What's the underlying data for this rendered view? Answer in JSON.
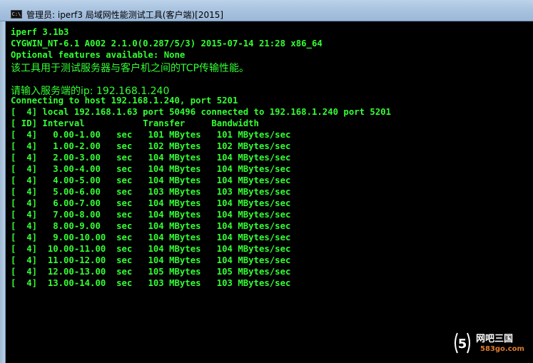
{
  "window": {
    "title": "管理员: iperf3 局域网性能测试工具(客户端)[2015]",
    "icon_label": "C:\\",
    "icon": "console-window-icon"
  },
  "console": {
    "lines": [
      "iperf 3.1b3",
      "CYGWIN_NT-6.1 A002 2.1.0(0.287/5/3) 2015-07-14 21:28 x86_64",
      "Optional features available: None",
      "该工具用于测试服务器与客户机之间的TCP传输性能。",
      "",
      "请输入服务端的ip: 192.168.1.240",
      "Connecting to host 192.168.1.240, port 5201",
      "[  4] local 192.168.1.63 port 50496 connected to 192.168.1.240 port 5201",
      "[ ID] Interval           Transfer     Bandwidth",
      "[  4]   0.00-1.00   sec   101 MBytes   101 MBytes/sec",
      "[  4]   1.00-2.00   sec   102 MBytes   102 MBytes/sec",
      "[  4]   2.00-3.00   sec   104 MBytes   104 MBytes/sec",
      "[  4]   3.00-4.00   sec   104 MBytes   104 MBytes/sec",
      "[  4]   4.00-5.00   sec   104 MBytes   104 MBytes/sec",
      "[  4]   5.00-6.00   sec   103 MBytes   103 MBytes/sec",
      "[  4]   6.00-7.00   sec   104 MBytes   104 MBytes/sec",
      "[  4]   7.00-8.00   sec   104 MBytes   104 MBytes/sec",
      "[  4]   8.00-9.00   sec   104 MBytes   104 MBytes/sec",
      "[  4]   9.00-10.00  sec   104 MBytes   104 MBytes/sec",
      "[  4]  10.00-11.00  sec   104 MBytes   104 MBytes/sec",
      "[  4]  11.00-12.00  sec   104 MBytes   104 MBytes/sec",
      "[  4]  12.00-13.00  sec   105 MBytes   105 MBytes/sec",
      "[  4]  13.00-14.00  sec   103 MBytes   103 MBytes/sec"
    ]
  },
  "watermark": {
    "name": "网吧三国",
    "url": "583go.com",
    "logo": "583go-logo-icon",
    "logo_glyph": "5"
  },
  "colors": {
    "console_text": "#33ff33",
    "console_bg": "#000000",
    "watermark_url": "#e07d2a"
  }
}
